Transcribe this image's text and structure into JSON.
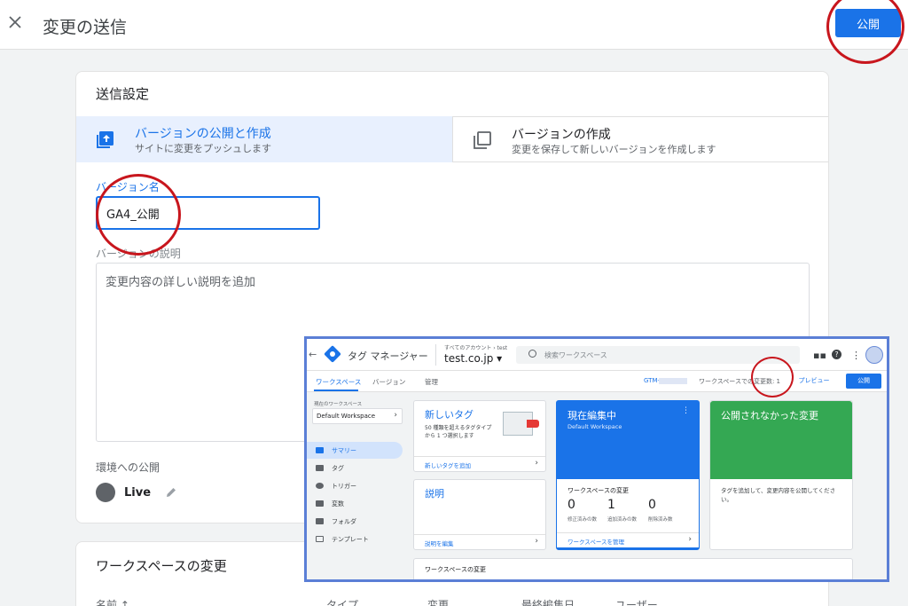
{
  "header": {
    "title": "変更の送信",
    "publish_label": "公開"
  },
  "settings": {
    "title": "送信設定",
    "options": [
      {
        "title": "バージョンの公開と作成",
        "subtitle": "サイトに変更をプッシュします",
        "selected": true
      },
      {
        "title": "バージョンの作成",
        "subtitle": "変更を保存して新しいバージョンを作成します",
        "selected": false
      }
    ],
    "version_name_label": "バージョン名",
    "version_name_value": "GA4_公開",
    "version_desc_label": "バージョンの説明",
    "version_desc_placeholder": "変更内容の詳しい説明を追加",
    "env_label": "環境への公開",
    "env_name": "Live"
  },
  "workspace_changes": {
    "title": "ワークスペースの変更",
    "columns": [
      "名前 ↑",
      "タイプ",
      "変更",
      "最終編集日",
      "ユーザー"
    ]
  },
  "inset": {
    "app_title": "タグ マネージャー",
    "breadcrumb": "すべてのアカウント › test",
    "account": "test.co.jp ▾",
    "search_placeholder": "検索ワークスペース",
    "tabs": [
      "ワークスペース",
      "バージョン",
      "管理"
    ],
    "gtm_prefix": "GTM-",
    "changes_text": "ワークスペースでの変更数: 1",
    "preview_label": "プレビュー",
    "submit_label": "公開",
    "ws_caption": "現在のワークスペース",
    "ws_name": "Default Workspace",
    "nav": [
      "サマリー",
      "タグ",
      "トリガー",
      "変数",
      "フォルダ",
      "テンプレート"
    ],
    "new_tag": {
      "title": "新しいタグ",
      "desc": "50 種類を超えるタグタイプから 1 つ選択します",
      "action": "新しいタグを追加"
    },
    "description_card": {
      "title": "説明",
      "action": "説明を編集"
    },
    "editing": {
      "title": "現在編集中",
      "subtitle": "Default Workspace",
      "changes_title": "ワークスペースの変更",
      "counts": [
        {
          "value": "0",
          "label": "修正済みの数"
        },
        {
          "value": "1",
          "label": "追加済みの数"
        },
        {
          "value": "0",
          "label": "削除済み数"
        }
      ],
      "action": "ワークスペースを管理"
    },
    "unpublished": {
      "title": "公開されなかった変更",
      "text": "タグを追加して、変更内容を公開してください。"
    },
    "bottom_title": "ワークスペースの変更"
  },
  "colors": {
    "accent": "#1a73e8",
    "annotation_red": "#c8161d",
    "inset_border": "#5b7fd6",
    "green_card": "#34a853"
  }
}
